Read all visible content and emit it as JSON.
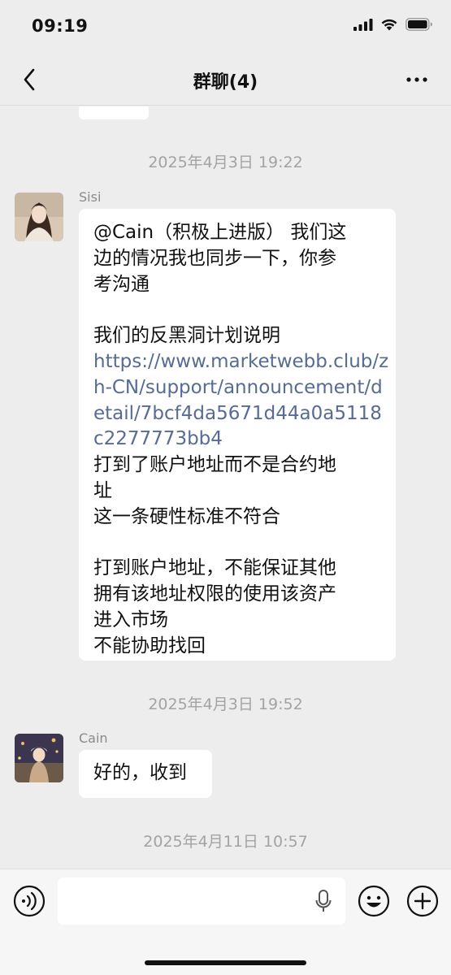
{
  "status_bar": {
    "time": "09:19"
  },
  "header": {
    "title": "群聊(4)"
  },
  "messages": [
    {
      "timestamp": "2025年4月3日 19:22",
      "sender": "Sisi",
      "lines": [
        "@Cain（积极上进版） 我们这",
        "边的情况我也同步一下，你参",
        "考沟通",
        "我们的反黑洞计划说明",
        "https://www.marketwebb.club/z",
        "h-CN/support/announcement/d",
        "etail/7bcf4da5671d44a0a5118",
        "c2277773bb4",
        "打到了账户地址而不是合约地",
        "址",
        "这一条硬性标准不符合",
        "打到账户地址，不能保证其他",
        "拥有该地址权限的使用该资产",
        "进入市场",
        "不能协助找回"
      ]
    },
    {
      "timestamp": "2025年4月3日 19:52",
      "sender": "Cain",
      "lines": [
        "好的，收到"
      ]
    },
    {
      "timestamp": "2025年4月11日 10:57"
    }
  ],
  "colors": {
    "background": "#ededed",
    "bubble": "#ffffff",
    "link": "#576b95",
    "timestamp": "#a3a3a3"
  },
  "icons": [
    "back-arrow-icon",
    "more-icon",
    "voice-icon",
    "microphone-icon",
    "emoji-icon",
    "plus-icon",
    "signal-icon",
    "wifi-icon",
    "battery-icon"
  ]
}
